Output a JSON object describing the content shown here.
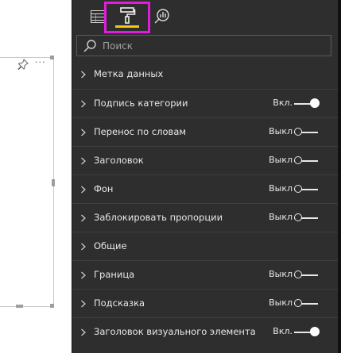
{
  "canvas": {
    "more_label": "···"
  },
  "pane": {
    "tabs": [
      {
        "name": "fields",
        "icon": "table-grid-icon"
      },
      {
        "name": "format",
        "icon": "paint-roller-icon",
        "active": true
      },
      {
        "name": "analytics",
        "icon": "magnifier-chart-icon"
      }
    ],
    "highlight_color": "#e31bdb",
    "active_underline_color": "#f2c811",
    "search": {
      "placeholder": "Поиск",
      "value": ""
    },
    "sections": [
      {
        "label": "Метка данных",
        "has_toggle": false
      },
      {
        "label": "Подпись категории",
        "has_toggle": true,
        "state": "on",
        "state_label": "Вкл."
      },
      {
        "label": "Перенос по словам",
        "has_toggle": true,
        "state": "off",
        "state_label": "Выкл"
      },
      {
        "label": "Заголовок",
        "has_toggle": true,
        "state": "off",
        "state_label": "Выкл"
      },
      {
        "label": "Фон",
        "has_toggle": true,
        "state": "off",
        "state_label": "Выкл"
      },
      {
        "label": "Заблокировать пропорции",
        "has_toggle": true,
        "state": "off",
        "state_label": "Выкл"
      },
      {
        "label": "Общие",
        "has_toggle": false
      },
      {
        "label": "Граница",
        "has_toggle": true,
        "state": "off",
        "state_label": "Выкл"
      },
      {
        "label": "Подсказка",
        "has_toggle": true,
        "state": "off",
        "state_label": "Выкл"
      },
      {
        "label": "Заголовок визуального элемента",
        "has_toggle": true,
        "state": "on",
        "state_label": "Вкл."
      }
    ]
  }
}
